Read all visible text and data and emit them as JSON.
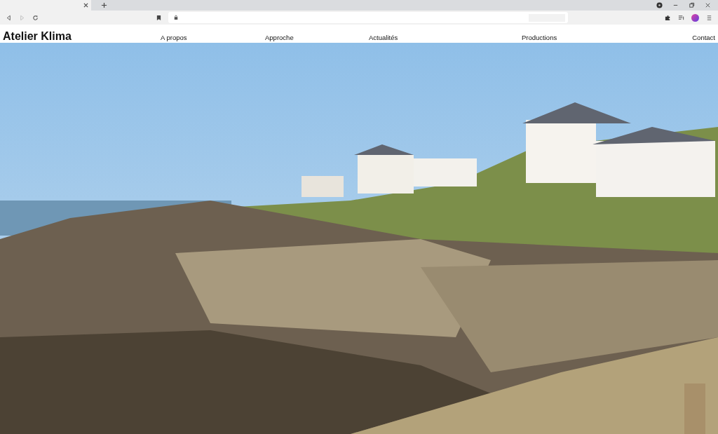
{
  "site": {
    "logo": "Atelier Klima"
  },
  "nav": [
    {
      "label": "A propos"
    },
    {
      "label": "Approche"
    },
    {
      "label": "Actualités"
    },
    {
      "label": "Productions"
    },
    {
      "label": "Contact"
    }
  ]
}
